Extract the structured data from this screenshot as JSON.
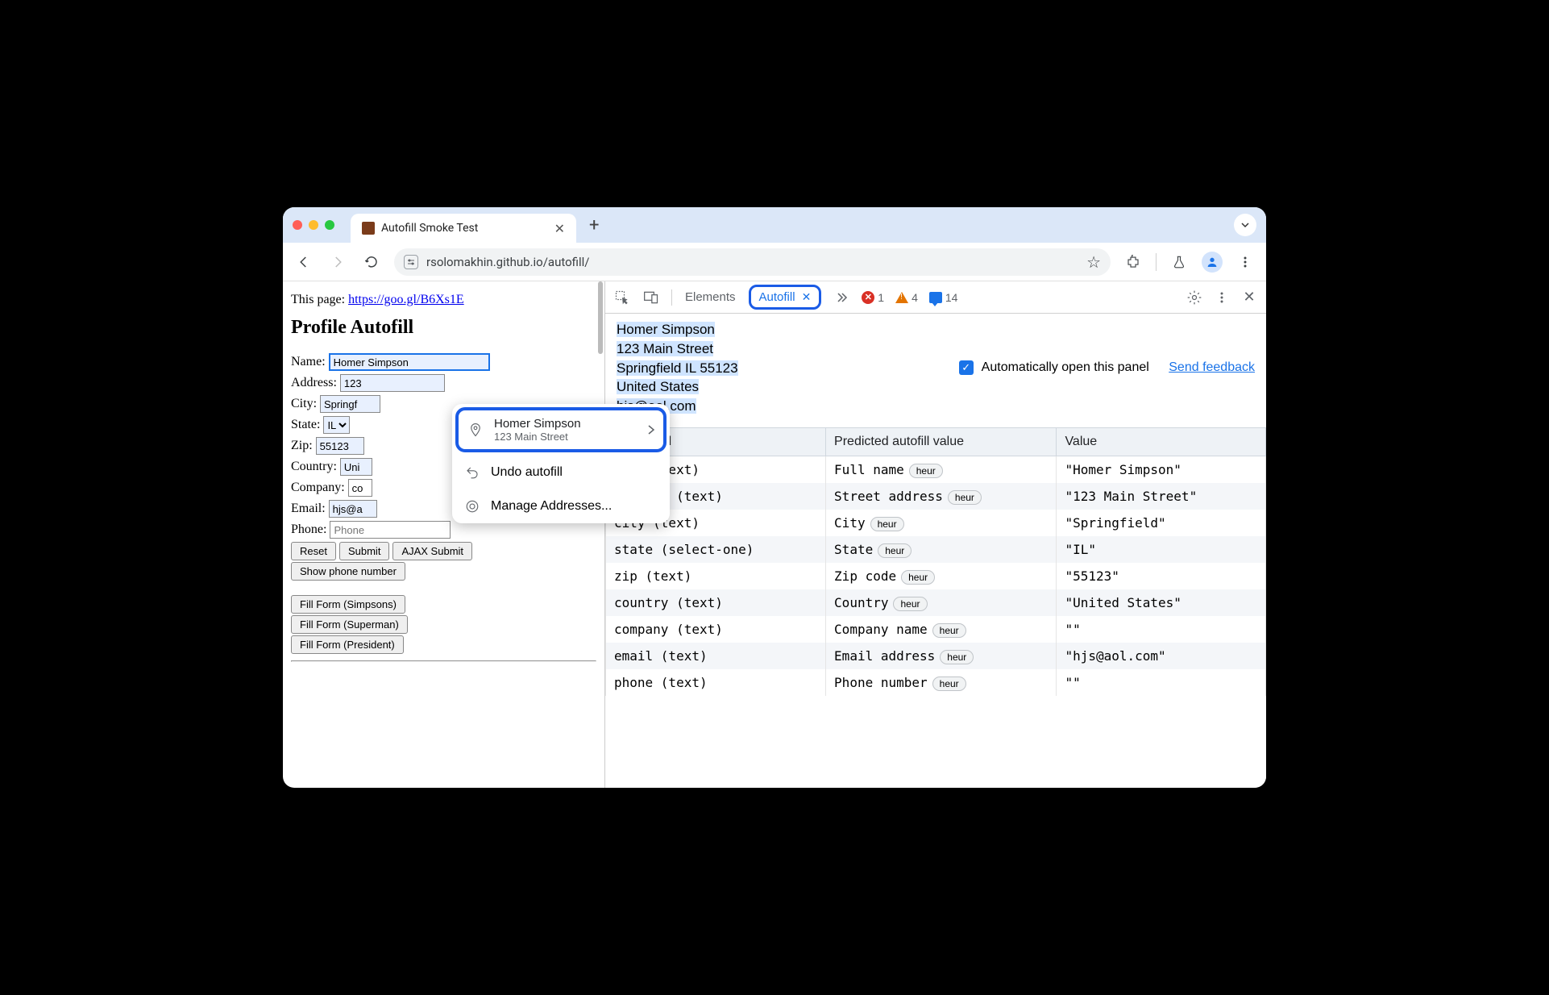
{
  "browser": {
    "tab_title": "Autofill Smoke Test",
    "url": "rsolomakhin.github.io/autofill/",
    "star": "☆"
  },
  "page": {
    "this_page_label": "This page: ",
    "this_page_link": "https://goo.gl/B6Xs1E",
    "heading": "Profile Autofill",
    "labels": {
      "name": "Name: ",
      "address": "Address: ",
      "city": "City: ",
      "state": "State: ",
      "zip": "Zip: ",
      "country": "Country: ",
      "company": "Company: ",
      "email": "Email: ",
      "phone": "Phone: "
    },
    "values": {
      "name": "Homer Simpson",
      "address": "123",
      "city": "Springf",
      "state": "IL",
      "zip": "55123",
      "country": "Uni",
      "company": "co",
      "email": "hjs@a",
      "phone_placeholder": "Phone"
    },
    "buttons": {
      "reset": "Reset",
      "submit": "Submit",
      "ajax": "AJAX Submit",
      "show_phone": "Show phone number",
      "fill_simpsons": "Fill Form (Simpsons)",
      "fill_superman": "Fill Form (Superman)",
      "fill_president": "Fill Form (President)"
    }
  },
  "popup": {
    "card_title": "Homer Simpson",
    "card_sub": "123 Main Street",
    "undo": "Undo autofill",
    "manage": "Manage Addresses..."
  },
  "devtools": {
    "tabs": {
      "elements": "Elements",
      "autofill": "Autofill"
    },
    "counts": {
      "errors": "1",
      "warnings": "4",
      "info": "14"
    },
    "auto_open": "Automatically open this panel",
    "send_feedback": "Send feedback",
    "address_lines": [
      "Homer Simpson",
      "123 Main Street",
      "Springfield IL 55123",
      "United States",
      "hjs@aol.com"
    ],
    "table": {
      "headers": [
        "Form field",
        "Predicted autofill value",
        "Value"
      ],
      "rows": [
        {
          "field": "name (text)",
          "pred": "Full name",
          "pill": "heur",
          "val": "\"Homer Simpson\""
        },
        {
          "field": "address (text)",
          "pred": "Street address",
          "pill": "heur",
          "val": "\"123 Main Street\""
        },
        {
          "field": "city (text)",
          "pred": "City",
          "pill": "heur",
          "val": "\"Springfield\""
        },
        {
          "field": "state (select-one)",
          "pred": "State",
          "pill": "heur",
          "val": "\"IL\""
        },
        {
          "field": "zip (text)",
          "pred": "Zip code",
          "pill": "heur",
          "val": "\"55123\""
        },
        {
          "field": "country (text)",
          "pred": "Country",
          "pill": "heur",
          "val": "\"United States\""
        },
        {
          "field": "company (text)",
          "pred": "Company name",
          "pill": "heur",
          "val": "\"\""
        },
        {
          "field": "email (text)",
          "pred": "Email address",
          "pill": "heur",
          "val": "\"hjs@aol.com\""
        },
        {
          "field": "phone (text)",
          "pred": "Phone number",
          "pill": "heur",
          "val": "\"\""
        }
      ]
    }
  }
}
